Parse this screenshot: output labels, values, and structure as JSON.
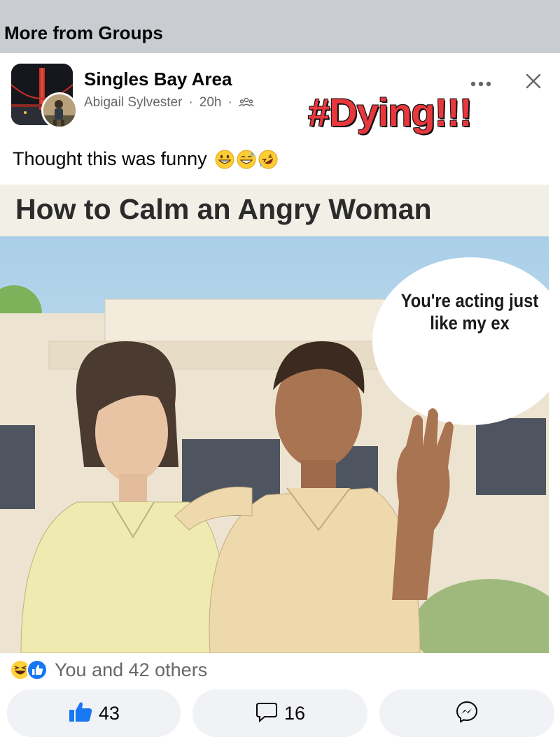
{
  "section": {
    "title": "More from Groups"
  },
  "post": {
    "group_name": "Singles Bay Area",
    "author": "Abigail Sylvester",
    "time": "20h",
    "separator": "·",
    "privacy_icon": "group-members-icon",
    "overlay_text": "#Dying!!!",
    "caption": "Thought this was funny",
    "caption_emojis": [
      "grinning-face-emoji",
      "sweat-smile-emoji",
      "rofl-emoji"
    ],
    "meme": {
      "title": "How to Calm an Angry Woman",
      "speech_bubble": "You're acting just like my ex"
    },
    "reactions": {
      "icons": [
        "haha-reaction-icon",
        "like-reaction-icon"
      ],
      "summary": "You and 42 others"
    },
    "actions": {
      "like_count": "43",
      "comment_count": "16"
    }
  },
  "colors": {
    "background": "#c9ccd1",
    "card": "#ffffff",
    "like_blue": "#1877f2",
    "overlay_red": "#e8383e",
    "secondary_text": "#65676b"
  }
}
